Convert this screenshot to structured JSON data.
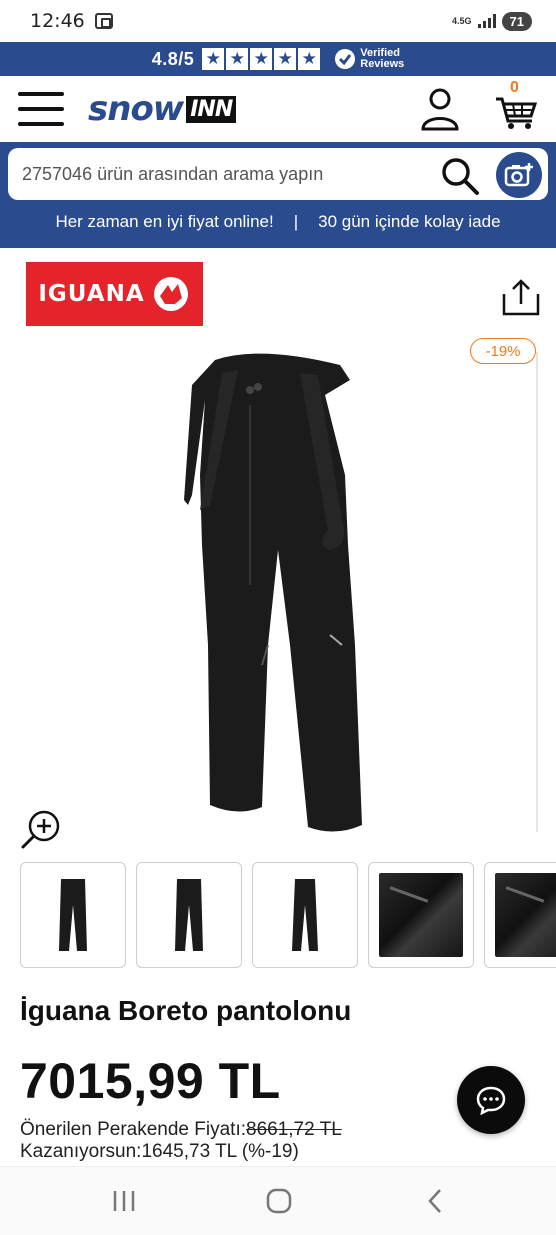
{
  "status_bar": {
    "time": "12:46",
    "network": "4.5G",
    "battery": "71"
  },
  "rating_bar": {
    "score": "4.8/5",
    "stars": 5,
    "verified_line1": "Verified",
    "verified_line2": "Reviews"
  },
  "header": {
    "logo_snow": "snow",
    "logo_inn": "INN",
    "cart_count": "0"
  },
  "search": {
    "placeholder": "2757046 ürün arasından arama yapın"
  },
  "promo": {
    "left": "Her zaman en iyi fiyat online!",
    "separator": "|",
    "right": "30 gün içinde kolay iade"
  },
  "brand": {
    "name": "IGUANA"
  },
  "product": {
    "discount_badge": "-19%",
    "title": "İguana Boreto pantolonu",
    "price": "7015,99 TL",
    "rrp_label": "Önerilen Perakende Fiyatı:",
    "rrp_value": "8661,72 TL",
    "saving": "Kazanıyorsun:1645,73 TL (%-19)"
  },
  "colors": {
    "brand_blue": "#2a4b8d",
    "accent_orange": "#f07a1a",
    "brand_red": "#e4242a"
  }
}
